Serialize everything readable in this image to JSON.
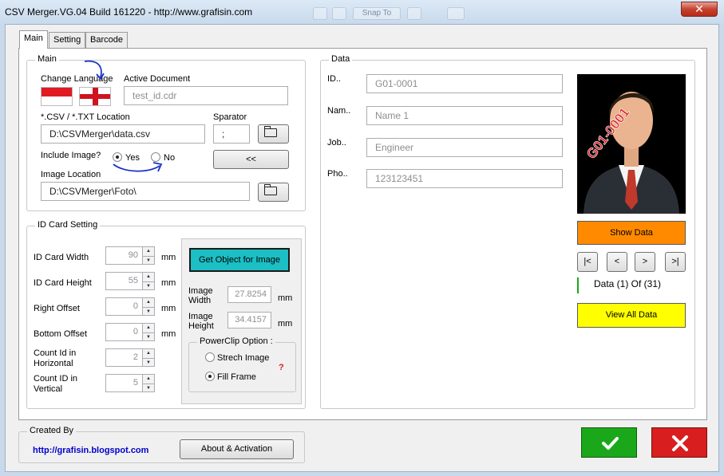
{
  "window": {
    "title": "CSV Merger.VG.04 Build 161220 - http://www.grafisin.com",
    "close_glyph": "✕"
  },
  "background_buttons": [
    "Snap To"
  ],
  "tabs": [
    {
      "label": "Main",
      "active": true
    },
    {
      "label": "Setting",
      "active": false
    },
    {
      "label": "Barcode",
      "active": false
    }
  ],
  "main_group": {
    "label": "Main",
    "change_language_label": "Change Language",
    "active_document_label": "Active Document",
    "active_document_value": "test_id.cdr",
    "csv_location_label": "*.CSV / *.TXT Location",
    "csv_location_value": "D:\\CSVMerger\\data.csv",
    "separator_label": "Sparator",
    "separator_value": ";",
    "include_image_label": "Include Image?",
    "radio_yes": "Yes",
    "radio_no": "No",
    "include_image_selected": "Yes",
    "prev_button": "<<",
    "image_location_label": "Image Location",
    "image_location_value": "D:\\CSVMerger\\Foto\\",
    "flags": [
      "indonesia-flag-icon",
      "england-flag-icon"
    ]
  },
  "id_card_group": {
    "label": "ID Card Setting",
    "unit": "mm",
    "fields": [
      {
        "label": "ID Card Width",
        "value": "90",
        "unit": "mm"
      },
      {
        "label": "ID Card Height",
        "value": "55",
        "unit": "mm"
      },
      {
        "label": "Right Offset",
        "value": "0",
        "unit": "mm"
      },
      {
        "label": "Bottom Offset",
        "value": "0",
        "unit": "mm"
      },
      {
        "label": "Count Id in Horizontal",
        "value": "2",
        "unit": ""
      },
      {
        "label": "Count ID in Vertical",
        "value": "5",
        "unit": ""
      }
    ],
    "get_object_button": "Get Object for Image",
    "image_width_label": "Image Width",
    "image_width_value": "27.8254",
    "image_height_label": "Image Height",
    "image_height_value": "34.4157",
    "powerclip_label": "PowerClip Option :",
    "option_stretch": "Strech Image",
    "option_fill": "Fill Frame",
    "powerclip_selected": "Fill Frame",
    "help_glyph": "?"
  },
  "data_group": {
    "label": "Data",
    "rows": [
      {
        "label": "ID..",
        "value": "G01-0001"
      },
      {
        "label": "Nam..",
        "value": "Name 1"
      },
      {
        "label": "Job..",
        "value": "Engineer"
      },
      {
        "label": "Pho..",
        "value": "123123451"
      }
    ],
    "photo_overlay_text": "G01-0001",
    "show_data_button": "Show Data",
    "nav": {
      "first": "|<",
      "prev": "<",
      "next": ">",
      "last": ">|"
    },
    "record_status": "Data (1) Of (31)",
    "view_all_button": "View All Data"
  },
  "created_by": {
    "label": "Created By",
    "link": "http://grafisin.blogspot.com",
    "about_button": "About & Activation"
  },
  "colors": {
    "get_object_bg": "#1bbfc4",
    "show_data_bg": "#ff8a00",
    "view_all_bg": "#ffff00",
    "ok_bg": "#1aa81a",
    "cancel_bg": "#d81e1e",
    "link": "#0000cc"
  }
}
